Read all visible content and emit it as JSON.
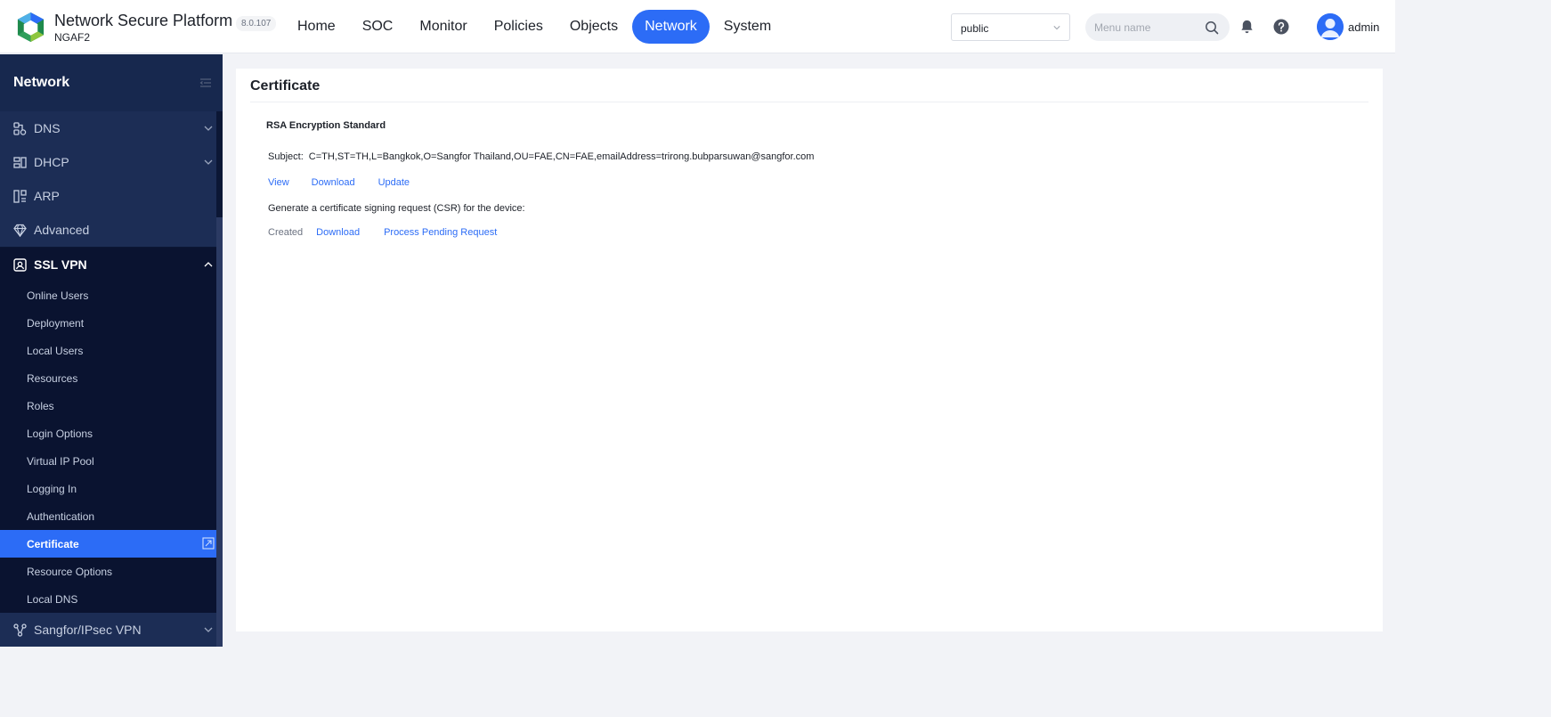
{
  "header": {
    "product_title": "Network Secure Platform",
    "product_sub": "NGAF2",
    "version": "8.0.107",
    "nav": [
      {
        "label": "Home",
        "active": false
      },
      {
        "label": "SOC",
        "active": false
      },
      {
        "label": "Monitor",
        "active": false
      },
      {
        "label": "Policies",
        "active": false
      },
      {
        "label": "Objects",
        "active": false
      },
      {
        "label": "Network",
        "active": true
      },
      {
        "label": "System",
        "active": false
      }
    ],
    "tenant_value": "public",
    "search_placeholder": "Menu name",
    "username": "admin"
  },
  "sidebar": {
    "title": "Network",
    "groups": [
      {
        "label": "DNS",
        "icon": "dns-icon",
        "open": false
      },
      {
        "label": "DHCP",
        "icon": "dhcp-icon",
        "open": false
      },
      {
        "label": "ARP",
        "icon": "arp-icon",
        "open": false
      },
      {
        "label": "Advanced",
        "icon": "diamond-icon",
        "open": false
      },
      {
        "label": "SSL VPN",
        "icon": "ssl-vpn-icon",
        "open": true
      },
      {
        "label": "Sangfor/IPsec VPN",
        "icon": "vpn-nodes-icon",
        "open": false
      }
    ],
    "ssl_vpn_items": [
      {
        "label": "Online Users",
        "active": false
      },
      {
        "label": "Deployment",
        "active": false
      },
      {
        "label": "Local Users",
        "active": false
      },
      {
        "label": "Resources",
        "active": false
      },
      {
        "label": "Roles",
        "active": false
      },
      {
        "label": "Login Options",
        "active": false
      },
      {
        "label": "Virtual IP Pool",
        "active": false
      },
      {
        "label": "Logging In",
        "active": false
      },
      {
        "label": "Authentication",
        "active": false
      },
      {
        "label": "Certificate",
        "active": true
      },
      {
        "label": "Resource Options",
        "active": false
      },
      {
        "label": "Local DNS",
        "active": false
      }
    ]
  },
  "content": {
    "title": "Certificate",
    "section_title": "RSA Encryption Standard",
    "subject_label": "Subject:",
    "subject_value": "C=TH,ST=TH,L=Bangkok,O=Sangfor Thailand,OU=FAE,CN=FAE,emailAddress=trirong.bubparsuwan@sangfor.com",
    "cert_links": {
      "view": "View",
      "download": "Download",
      "update": "Update"
    },
    "csr_text": "Generate a certificate signing request (CSR) for the device:",
    "csr_status": "Created",
    "csr_links": {
      "download": "Download",
      "process": "Process Pending Request"
    }
  },
  "colors": {
    "accent": "#2c6cf6",
    "sidebar_bg": "#0c1735",
    "sidebar_group_bg": "#1c2d55",
    "page_bg": "#f2f3f7"
  }
}
